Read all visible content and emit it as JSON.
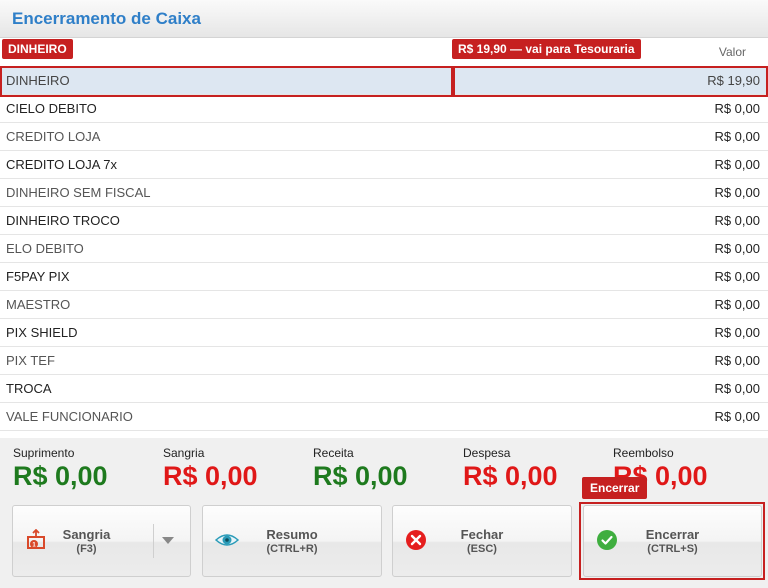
{
  "window": {
    "title": "Encerramento de Caixa"
  },
  "table": {
    "column_valor": "Valor"
  },
  "annotations": {
    "selected_row_tag": "DINHEIRO",
    "selected_value_tag": "R$ 19,90 — vai para Tesouraria",
    "button_tag": "Encerrar"
  },
  "rows": [
    {
      "name": "DINHEIRO",
      "value": "R$ 19,90"
    },
    {
      "name": "CIELO DEBITO",
      "value": "R$ 0,00"
    },
    {
      "name": "CREDITO LOJA",
      "value": "R$ 0,00"
    },
    {
      "name": "CREDITO LOJA 7x",
      "value": "R$ 0,00"
    },
    {
      "name": "DINHEIRO SEM FISCAL",
      "value": "R$ 0,00"
    },
    {
      "name": "DINHEIRO TROCO",
      "value": "R$ 0,00"
    },
    {
      "name": "ELO DEBITO",
      "value": "R$ 0,00"
    },
    {
      "name": "F5PAY PIX",
      "value": "R$ 0,00"
    },
    {
      "name": "MAESTRO",
      "value": "R$ 0,00"
    },
    {
      "name": "PIX SHIELD",
      "value": "R$ 0,00"
    },
    {
      "name": "PIX TEF",
      "value": "R$ 0,00"
    },
    {
      "name": "TROCA",
      "value": "R$ 0,00"
    },
    {
      "name": "VALE FUNCIONARIO",
      "value": "R$ 0,00"
    }
  ],
  "totals": {
    "suprimento": {
      "label": "Suprimento",
      "amount": "R$ 0,00"
    },
    "sangria": {
      "label": "Sangria",
      "amount": "R$ 0,00"
    },
    "receita": {
      "label": "Receita",
      "amount": "R$ 0,00"
    },
    "despesa": {
      "label": "Despesa",
      "amount": "R$ 0,00"
    },
    "reembolso": {
      "label": "Reembolso",
      "amount": "R$ 0,00"
    }
  },
  "buttons": {
    "sangria": {
      "label": "Sangria",
      "shortcut": "(F3)",
      "icon": "cash-out-icon"
    },
    "resumo": {
      "label": "Resumo",
      "shortcut": "(CTRL+R)",
      "icon": "eye-icon"
    },
    "fechar": {
      "label": "Fechar",
      "shortcut": "(ESC)",
      "icon": "close-circle-icon"
    },
    "encerrar": {
      "label": "Encerrar",
      "shortcut": "(CTRL+S)",
      "icon": "check-circle-icon"
    }
  },
  "colors": {
    "title": "#2f7fc8",
    "positive": "#1e7a1e",
    "negative": "#e01818",
    "annotation": "#c62020",
    "selected_row": "#dde7f2"
  }
}
